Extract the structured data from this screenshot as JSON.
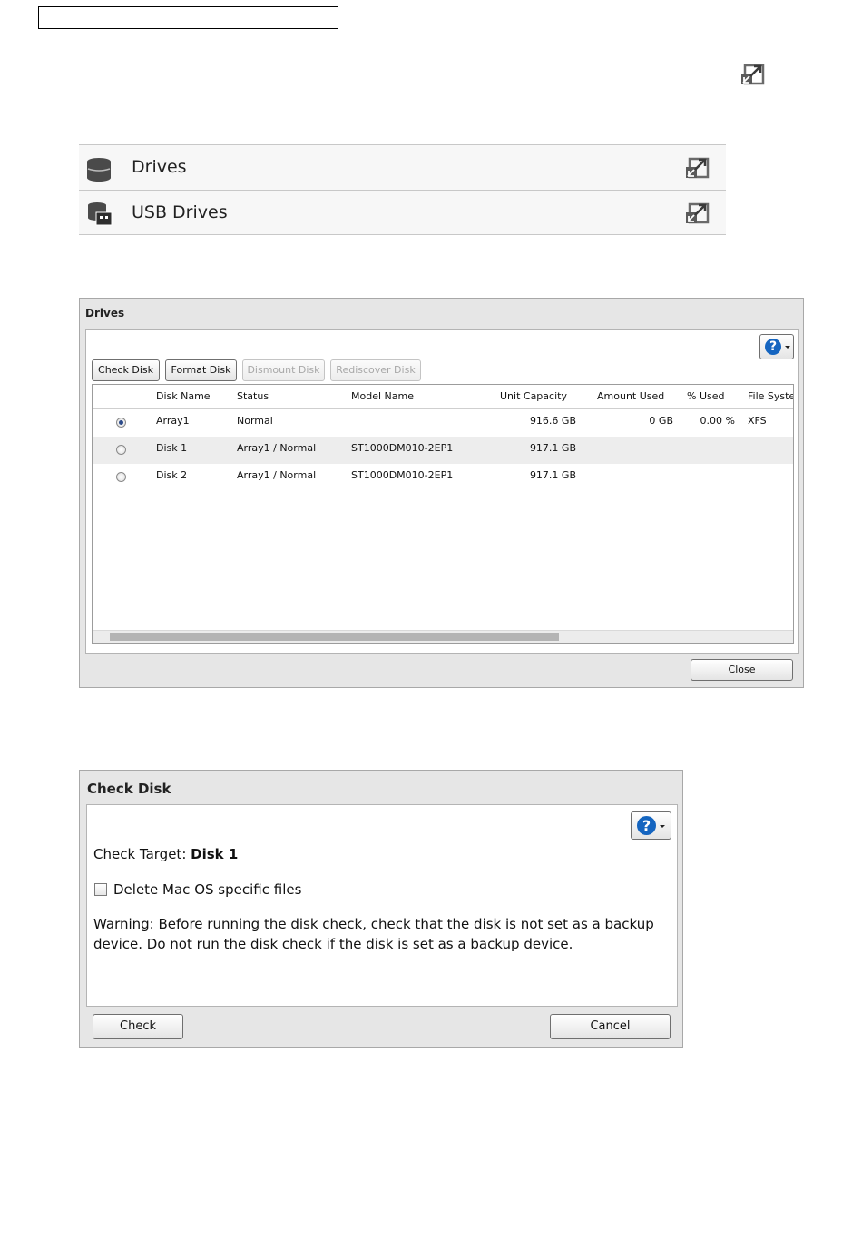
{
  "settings": {
    "items": [
      {
        "label": "Drives",
        "icon": "drives-icon"
      },
      {
        "label": "USB Drives",
        "icon": "usb-drives-icon"
      }
    ]
  },
  "drives_dialog": {
    "title": "Drives",
    "toolbar": {
      "check_disk": "Check Disk",
      "format_disk": "Format Disk",
      "dismount_disk": "Dismount Disk",
      "rediscover_disk": "Rediscover Disk"
    },
    "help": "?",
    "columns": [
      "Disk Name",
      "Status",
      "Model Name",
      "Unit Capacity",
      "Amount Used",
      "% Used",
      "File Syste"
    ],
    "rows": [
      {
        "selected": true,
        "name": "Array1",
        "status": "Normal",
        "model": "",
        "capacity": "916.6 GB",
        "used": "0 GB",
        "pct": "0.00 %",
        "fs": "XFS"
      },
      {
        "selected": false,
        "name": "Disk 1",
        "status": "Array1 / Normal",
        "model": "ST1000DM010-2EP1",
        "capacity": "917.1 GB",
        "used": "",
        "pct": "",
        "fs": ""
      },
      {
        "selected": false,
        "name": "Disk 2",
        "status": "Array1 / Normal",
        "model": "ST1000DM010-2EP1",
        "capacity": "917.1 GB",
        "used": "",
        "pct": "",
        "fs": ""
      }
    ],
    "close": "Close"
  },
  "check_dialog": {
    "title": "Check Disk",
    "help": "?",
    "target_label": "Check Target:",
    "target_value": "Disk 1",
    "option_label": "Delete Mac OS specific files",
    "option_checked": false,
    "warning_line1": "Warning: Before running the disk check, check that the disk is not set as a backup",
    "warning_line2": "device. Do not run the disk check if the disk is set as a backup device.",
    "check": "Check",
    "cancel": "Cancel"
  }
}
